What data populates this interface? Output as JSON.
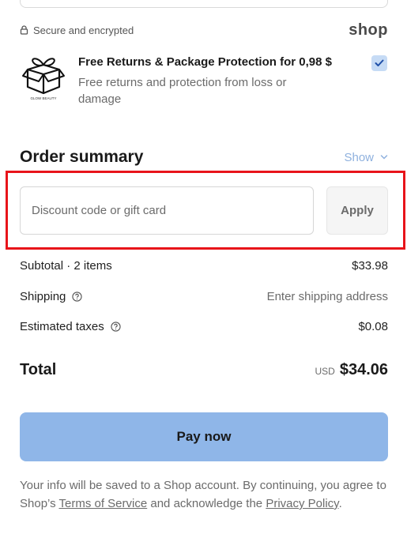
{
  "secure": {
    "text": "Secure and encrypted",
    "icon": "lock-icon"
  },
  "shop_logo": "shop",
  "protection": {
    "title": "Free Returns & Package Protection for 0,98 $",
    "description": "Free returns and protection from loss or damage",
    "logo_text": "GLOW BEAUTY",
    "checked": true
  },
  "summary": {
    "title": "Order summary",
    "toggle_label": "Show"
  },
  "discount": {
    "placeholder": "Discount code or gift card",
    "apply_label": "Apply"
  },
  "lines": {
    "subtotal_label": "Subtotal · 2 items",
    "subtotal_value": "$33.98",
    "shipping_label": "Shipping",
    "shipping_value": "Enter shipping address",
    "taxes_label": "Estimated taxes",
    "taxes_value": "$0.08"
  },
  "total": {
    "label": "Total",
    "currency": "USD",
    "value": "$34.06"
  },
  "pay": {
    "label": "Pay now"
  },
  "info": {
    "prefix": "Your info will be saved to a Shop account. By continuing, you agree to Shop’s ",
    "terms_link": "Terms of Service",
    "middle": " and acknowledge the ",
    "privacy_link": "Privacy Policy",
    "suffix": "."
  },
  "colors": {
    "accent_blue": "#8fb6e8",
    "highlight_red": "#e8141a",
    "checkbox_bg": "#c6dbf5"
  }
}
